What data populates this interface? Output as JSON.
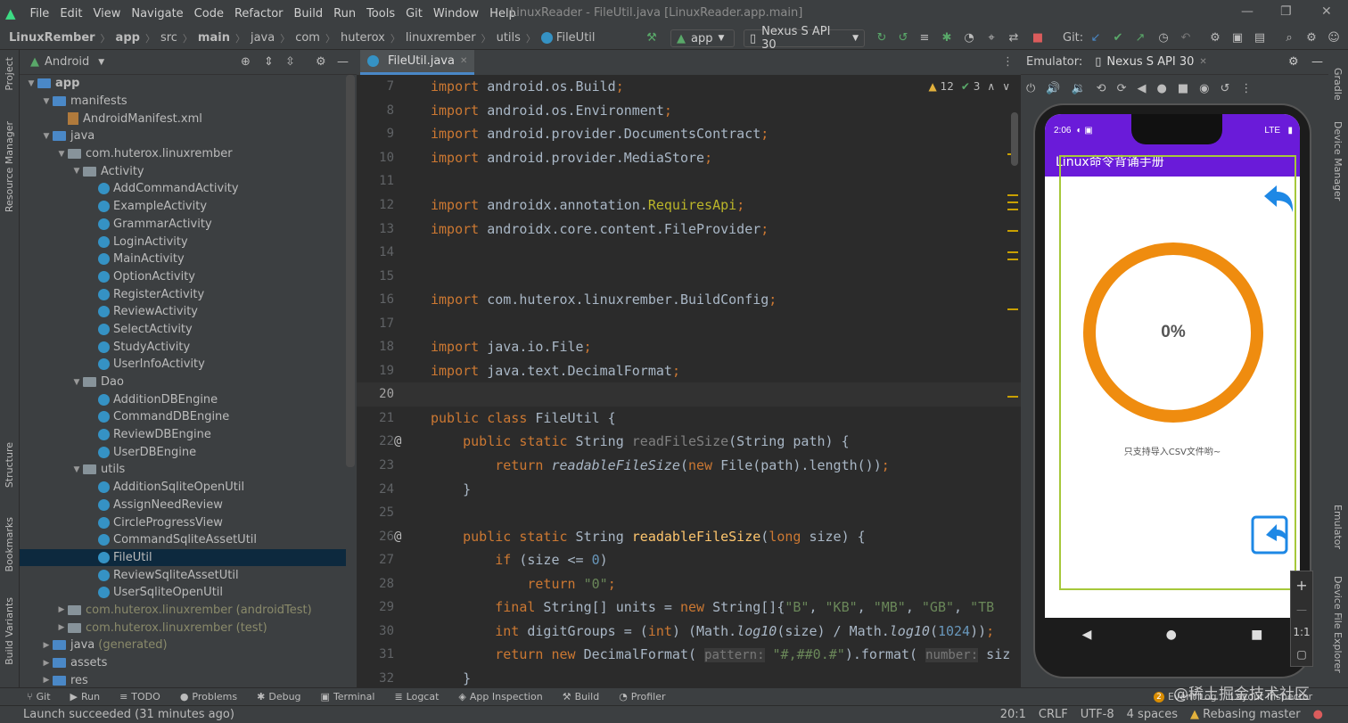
{
  "menu": [
    "File",
    "Edit",
    "View",
    "Navigate",
    "Code",
    "Refactor",
    "Build",
    "Run",
    "Tools",
    "Git",
    "Window",
    "Help"
  ],
  "window_title": "LinuxReader - FileUtil.java [LinuxReader.app.main]",
  "breadcrumbs": [
    "LinuxRember",
    "app",
    "src",
    "main",
    "java",
    "com",
    "huterox",
    "linuxrember",
    "utils",
    "FileUtil"
  ],
  "toolbar": {
    "run_config": "app",
    "device": "Nexus S API 30",
    "git_label": "Git:"
  },
  "project": {
    "view_label": "Android",
    "tree": [
      {
        "label": "app",
        "depth": 0,
        "type": "folder",
        "open": true
      },
      {
        "label": "manifests",
        "depth": 1,
        "type": "folder",
        "open": true
      },
      {
        "label": "AndroidManifest.xml",
        "depth": 2,
        "type": "xml"
      },
      {
        "label": "java",
        "depth": 1,
        "type": "folder",
        "open": true
      },
      {
        "label": "com.huterox.linuxrember",
        "depth": 2,
        "type": "package",
        "open": true
      },
      {
        "label": "Activity",
        "depth": 3,
        "type": "package",
        "open": true
      },
      {
        "label": "AddCommandActivity",
        "depth": 4,
        "type": "class"
      },
      {
        "label": "ExampleActivity",
        "depth": 4,
        "type": "class"
      },
      {
        "label": "GrammarActivity",
        "depth": 4,
        "type": "class"
      },
      {
        "label": "LoginActivity",
        "depth": 4,
        "type": "class"
      },
      {
        "label": "MainActivity",
        "depth": 4,
        "type": "class"
      },
      {
        "label": "OptionActivity",
        "depth": 4,
        "type": "class"
      },
      {
        "label": "RegisterActivity",
        "depth": 4,
        "type": "class"
      },
      {
        "label": "ReviewActivity",
        "depth": 4,
        "type": "class"
      },
      {
        "label": "SelectActivity",
        "depth": 4,
        "type": "class"
      },
      {
        "label": "StudyActivity",
        "depth": 4,
        "type": "class"
      },
      {
        "label": "UserInfoActivity",
        "depth": 4,
        "type": "class"
      },
      {
        "label": "Dao",
        "depth": 3,
        "type": "package",
        "open": true
      },
      {
        "label": "AdditionDBEngine",
        "depth": 4,
        "type": "class"
      },
      {
        "label": "CommandDBEngine",
        "depth": 4,
        "type": "class"
      },
      {
        "label": "ReviewDBEngine",
        "depth": 4,
        "type": "class"
      },
      {
        "label": "UserDBEngine",
        "depth": 4,
        "type": "class"
      },
      {
        "label": "utils",
        "depth": 3,
        "type": "package",
        "open": true
      },
      {
        "label": "AdditionSqliteOpenUtil",
        "depth": 4,
        "type": "class"
      },
      {
        "label": "AssignNeedReview",
        "depth": 4,
        "type": "class"
      },
      {
        "label": "CircleProgressView",
        "depth": 4,
        "type": "class"
      },
      {
        "label": "CommandSqliteAssetUtil",
        "depth": 4,
        "type": "class"
      },
      {
        "label": "FileUtil",
        "depth": 4,
        "type": "class",
        "selected": true
      },
      {
        "label": "ReviewSqliteAssetUtil",
        "depth": 4,
        "type": "class"
      },
      {
        "label": "UserSqliteOpenUtil",
        "depth": 4,
        "type": "class"
      },
      {
        "label": "com.huterox.linuxrember",
        "suffix": "(androidTest)",
        "depth": 2,
        "type": "package",
        "open": false,
        "test": true
      },
      {
        "label": "com.huterox.linuxrember",
        "suffix": "(test)",
        "depth": 2,
        "type": "package",
        "open": false,
        "test": true
      },
      {
        "label": "java",
        "suffix": "(generated)",
        "depth": 1,
        "type": "folder",
        "open": false
      },
      {
        "label": "assets",
        "depth": 1,
        "type": "folder",
        "open": false
      },
      {
        "label": "res",
        "depth": 1,
        "type": "folder",
        "open": false
      }
    ]
  },
  "editor": {
    "tab_label": "FileUtil.java",
    "warnings": "12",
    "weak_warnings": "3",
    "lines": [
      {
        "n": "7",
        "html": "<span class=\"kw\">import</span> android.os.Build<span class=\"kw\">;</span>"
      },
      {
        "n": "8",
        "html": "<span class=\"kw\">import</span> android.os.Environment<span class=\"kw\">;</span>"
      },
      {
        "n": "9",
        "html": "<span class=\"kw\">import</span> android.provider.DocumentsContract<span class=\"kw\">;</span>"
      },
      {
        "n": "10",
        "html": "<span class=\"kw\">import</span> android.provider.MediaStore<span class=\"kw\">;</span>"
      },
      {
        "n": "11",
        "html": ""
      },
      {
        "n": "12",
        "html": "<span class=\"kw\">import</span> androidx.annotation.<span class=\"ann\">RequiresApi</span><span class=\"kw\">;</span>"
      },
      {
        "n": "13",
        "html": "<span class=\"kw\">import</span> androidx.core.content.FileProvider<span class=\"kw\">;</span>"
      },
      {
        "n": "14",
        "html": ""
      },
      {
        "n": "15",
        "html": ""
      },
      {
        "n": "16",
        "html": "<span class=\"kw\">import</span> com.huterox.linuxrember.BuildConfig<span class=\"kw\">;</span>"
      },
      {
        "n": "17",
        "html": ""
      },
      {
        "n": "18",
        "html": "<span class=\"kw\">import</span> java.io.File<span class=\"kw\">;</span>"
      },
      {
        "n": "19",
        "html": "<span class=\"kw\">import</span> java.text.DecimalFormat<span class=\"kw\">;</span>"
      },
      {
        "n": "20",
        "html": "",
        "current": true
      },
      {
        "n": "21",
        "html": "<span class=\"kw\">public class</span> FileUtil {"
      },
      {
        "n": "22",
        "html": "    <span class=\"kw\">public static</span> String <span class=\"gray\">readFileSize</span>(String path) {",
        "gutter": "@"
      },
      {
        "n": "23",
        "html": "        <span class=\"kw\">return</span> <span class=\"it\">readableFileSize</span>(<span class=\"kw\">new</span> File(path).length())<span class=\"kw\">;</span>"
      },
      {
        "n": "24",
        "html": "    }"
      },
      {
        "n": "25",
        "html": ""
      },
      {
        "n": "26",
        "html": "    <span class=\"kw\">public static</span> String <span class=\"fn\">readableFileSize</span>(<span class=\"kw\">long</span> size) {",
        "gutter": "@"
      },
      {
        "n": "27",
        "html": "        <span class=\"kw\">if</span> (size &lt;= <span class=\"nm\">0</span>)"
      },
      {
        "n": "28",
        "html": "            <span class=\"kw\">return</span> <span class=\"st\">\"0\"</span><span class=\"kw\">;</span>"
      },
      {
        "n": "29",
        "html": "        <span class=\"kw\">final</span> String[] units = <span class=\"kw\">new</span> String[]{<span class=\"st\">\"B\"</span>, <span class=\"st\">\"KB\"</span>, <span class=\"st\">\"MB\"</span>, <span class=\"st\">\"GB\"</span>, <span class=\"st\">\"TB</span>"
      },
      {
        "n": "30",
        "html": "        <span class=\"kw\">int</span> digitGroups = (<span class=\"kw\">int</span>) (Math.<span class=\"it\">log10</span>(size) / Math.<span class=\"it\">log10</span>(<span class=\"nm\">1024</span>))<span class=\"kw\">;</span>"
      },
      {
        "n": "31",
        "html": "        <span class=\"kw\">return new</span> DecimalFormat( <span class=\"hint\">pattern:</span> <span class=\"st\">\"#,##0.#\"</span>).format( <span class=\"hint\">number:</span> siz"
      },
      {
        "n": "32",
        "html": "    }"
      }
    ]
  },
  "emulator": {
    "label": "Emulator:",
    "tab": "Nexus S API 30",
    "status_time": "2:06",
    "status_lte": "LTE",
    "app_title": "Linux命令背诵手册",
    "progress": "0%",
    "hint": "只支持导入CSV文件哟~",
    "zoom": "1:1"
  },
  "bottom_tools": [
    "Git",
    "Run",
    "TODO",
    "Problems",
    "Debug",
    "Terminal",
    "Logcat",
    "App Inspection",
    "Build",
    "Profiler"
  ],
  "bottom_right": [
    "Event Log",
    "Layout Inspector"
  ],
  "left_tools": [
    "Project",
    "Resource Manager",
    "Structure",
    "Bookmarks",
    "Build Variants"
  ],
  "right_tools": [
    "Gradle",
    "Device Manager",
    "Emulator",
    "Device File Explorer"
  ],
  "status": {
    "message": "Launch succeeded (31 minutes ago)",
    "position": "20:1",
    "line_sep": "CRLF",
    "encoding": "UTF-8",
    "indent": "4 spaces",
    "branch": "Rebasing master"
  },
  "watermark": "@稀土掘金技术社区",
  "event_count": "2"
}
